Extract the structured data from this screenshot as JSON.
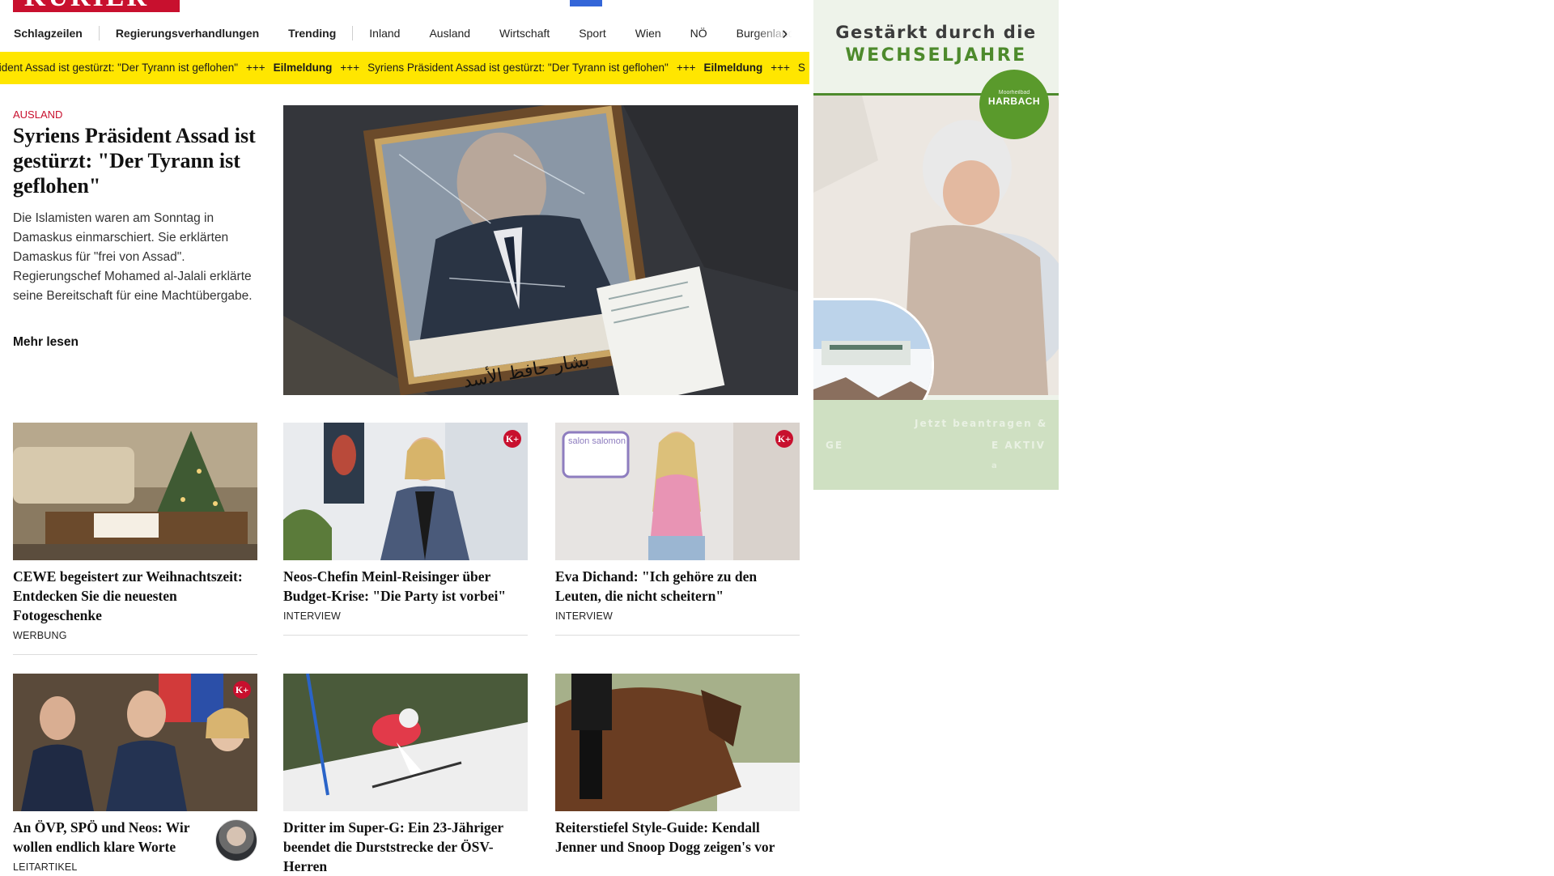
{
  "brand": {
    "logo_text": "KURIER",
    "logo_color": "#c8102e"
  },
  "nav": {
    "items": [
      {
        "label": "Schlagzeilen",
        "bold": true
      },
      {
        "label": "Regierungsverhandlungen",
        "bold": true
      },
      {
        "label": "Trending",
        "bold": true
      },
      {
        "label": "Inland"
      },
      {
        "label": "Ausland"
      },
      {
        "label": "Wirtschaft"
      },
      {
        "label": "Sport"
      },
      {
        "label": "Wien"
      },
      {
        "label": "NÖ"
      },
      {
        "label": "Burgenland"
      }
    ],
    "next_icon": "chevron-right-icon"
  },
  "ticker": {
    "background": "#ffe600",
    "headline": "Syriens Präsident Assad ist gestürzt: \"Der Tyrann ist geflohen\"",
    "headline_cut": "sident Assad ist gestürzt: \"Der Tyrann ist geflohen\"",
    "separator": "+++",
    "label": "Eilmeldung",
    "tail": "S"
  },
  "lead": {
    "kicker": "AUSLAND",
    "title": "Syriens Präsident Assad ist gestürzt: \"Der Tyrann ist geflohen\"",
    "teaser": "Die Islamisten waren am Sonntag in Damaskus einmarschiert. Sie erklärten Damaskus für \"frei von Assad\". Regierungschef Mohamed al-Jalali erklärte seine Bereitschaft für eine Machtübergabe.",
    "more": "Mehr lesen",
    "image_caption_arabic": "بشار حافظ الأسد"
  },
  "cards": [
    {
      "title": "CEWE begeistert zur Weihnachts­zeit: Entdecken Sie die neuesten Fotogeschenke",
      "tag": "WERBUNG"
    },
    {
      "title": "Neos-Chefin Meinl-Reisinger über Budget-Krise: \"Die Party ist vorbei\"",
      "tag": "INTERVIEW",
      "premium": "K+"
    },
    {
      "title": "Eva Dichand: \"Ich gehöre zu den Leuten, die nicht scheitern\"",
      "tag": "INTERVIEW",
      "premium": "K+",
      "overlay_logo": "salon salomon"
    },
    {
      "title": "An ÖVP, SPÖ und Neos: Wir wollen endlich klare Worte",
      "tag": "LEITARTIKEL",
      "premium": "K+"
    },
    {
      "title": "Dritter im Super-G: Ein 23-Jähriger beendet die Durststrecke der ÖSV-Herren",
      "tag": ""
    },
    {
      "title": "Reiterstiefel Style-Guide: Kendall Jenner und Snoop Dogg zeigen's vor",
      "tag": ""
    }
  ],
  "ad": {
    "headline_1": "Gestärkt durch die",
    "headline_2": "WECHSELJAHRE",
    "badge_small": "Moorheilbad",
    "badge_big": "HARBACH",
    "cta": "Jetzt beantragen &",
    "line_a": "GE",
    "line_b": "E AKTIV",
    "line_c": "a",
    "accent": "#4d8a2c"
  }
}
